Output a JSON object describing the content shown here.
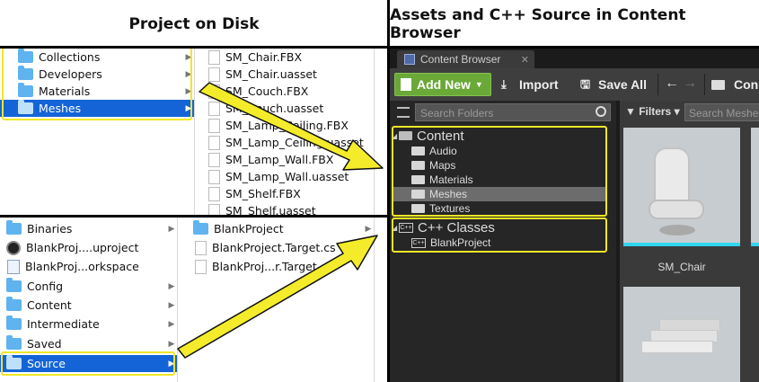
{
  "headers": {
    "left": "Project on Disk",
    "right": "Assets and C++ Source in Content Browser"
  },
  "finder_top": {
    "col1": [
      {
        "label": "Collections",
        "selected": false
      },
      {
        "label": "Developers",
        "selected": false
      },
      {
        "label": "Materials",
        "selected": false
      },
      {
        "label": "Meshes",
        "selected": true
      }
    ],
    "col2": [
      "SM_Chair.FBX",
      "SM_Chair.uasset",
      "SM_Couch.FBX",
      "SM_Couch.uasset",
      "SM_Lamp_Ceiling.FBX",
      "SM_Lamp_Ceiling.uasset",
      "SM_Lamp_Wall.FBX",
      "SM_Lamp_Wall.uasset",
      "SM_Shelf.FBX",
      "SM_Shelf.uasset"
    ]
  },
  "finder_bottom": {
    "col1": [
      {
        "label": "Binaries",
        "icon": "folder",
        "selected": false
      },
      {
        "label": "BlankProj....uproject",
        "icon": "uproject",
        "selected": false
      },
      {
        "label": "BlankProj...orkspace",
        "icon": "xcode",
        "selected": false
      },
      {
        "label": "Config",
        "icon": "folder",
        "selected": false
      },
      {
        "label": "Content",
        "icon": "folder",
        "selected": false
      },
      {
        "label": "Intermediate",
        "icon": "folder",
        "selected": false
      },
      {
        "label": "Saved",
        "icon": "folder",
        "selected": false
      },
      {
        "label": "Source",
        "icon": "folder",
        "selected": true
      }
    ],
    "col2": [
      {
        "label": "BlankProject",
        "icon": "folder"
      },
      {
        "label": "BlankProject.Target.cs",
        "icon": "doc"
      },
      {
        "label": "BlankProj...r.Target.cs",
        "icon": "doc"
      }
    ]
  },
  "content_browser": {
    "tab_label": "Content Browser",
    "tab_close": "✕",
    "toolbar": {
      "add_new": "Add New",
      "import": "Import",
      "save_all": "Save All",
      "content": "Con"
    },
    "search_folders_placeholder": "Search Folders",
    "filters_label": "Filters",
    "search_assets_placeholder": "Search Meshes",
    "tree": {
      "content": {
        "label": "Content",
        "children": [
          "Audio",
          "Maps",
          "Materials",
          "Meshes",
          "Textures"
        ],
        "selected": "Meshes"
      },
      "cpp": {
        "label": "C++ Classes",
        "children": [
          "BlankProject"
        ]
      }
    },
    "assets": [
      {
        "label": "SM_Chair"
      }
    ],
    "colors": {
      "highlight": "#f0e626",
      "add_new_green": "#6aa938",
      "asset_bar": "#2fd6ee",
      "finder_selection": "#1464d8"
    }
  }
}
